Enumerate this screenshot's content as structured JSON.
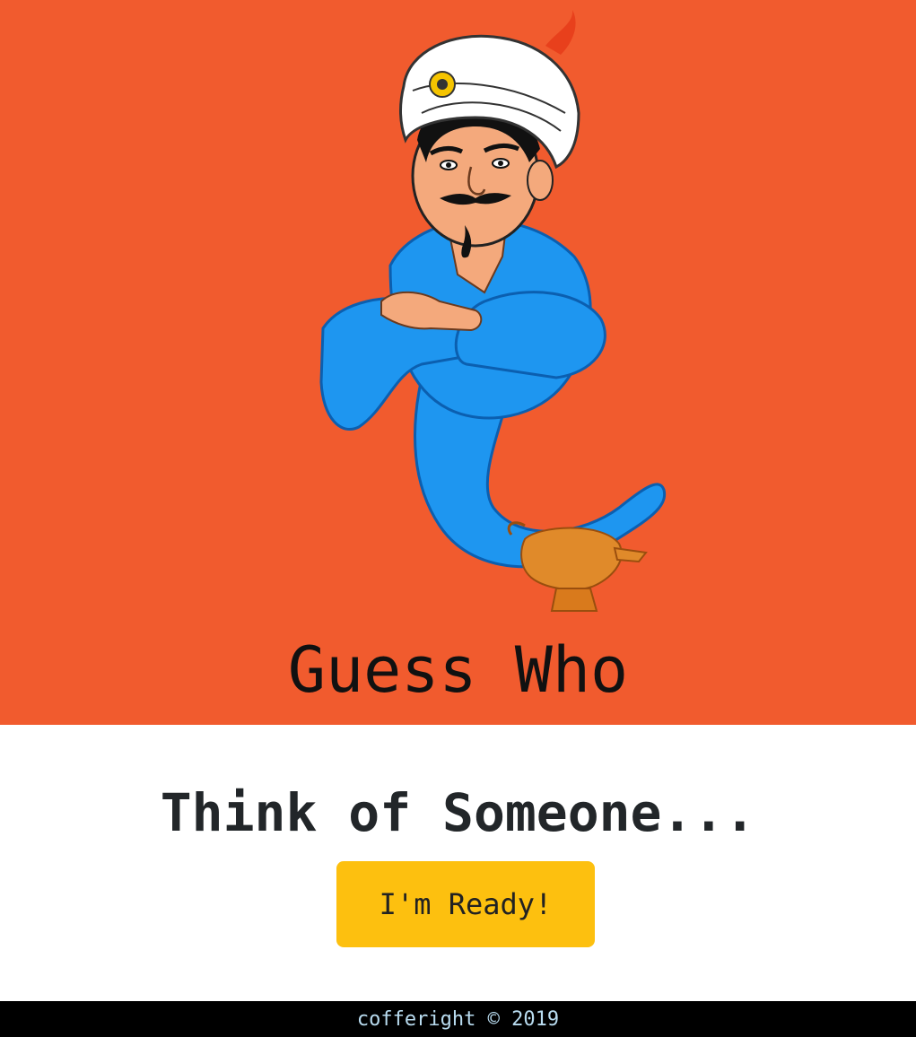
{
  "colors": {
    "hero_background": "#F15B2E",
    "button_background": "#FDC00F",
    "footer_background": "#000000",
    "footer_text": "#B9DCF0",
    "genie_robe": "#1E96F0",
    "turban": "#FFFFFF",
    "lamp": "#E08A2A"
  },
  "hero": {
    "title": "Guess Who",
    "illustration": "genie-illustration"
  },
  "main": {
    "prompt": "Think of Someone...",
    "ready_button_label": "I'm Ready!"
  },
  "footer": {
    "copyright": "cofferight © 2019"
  }
}
